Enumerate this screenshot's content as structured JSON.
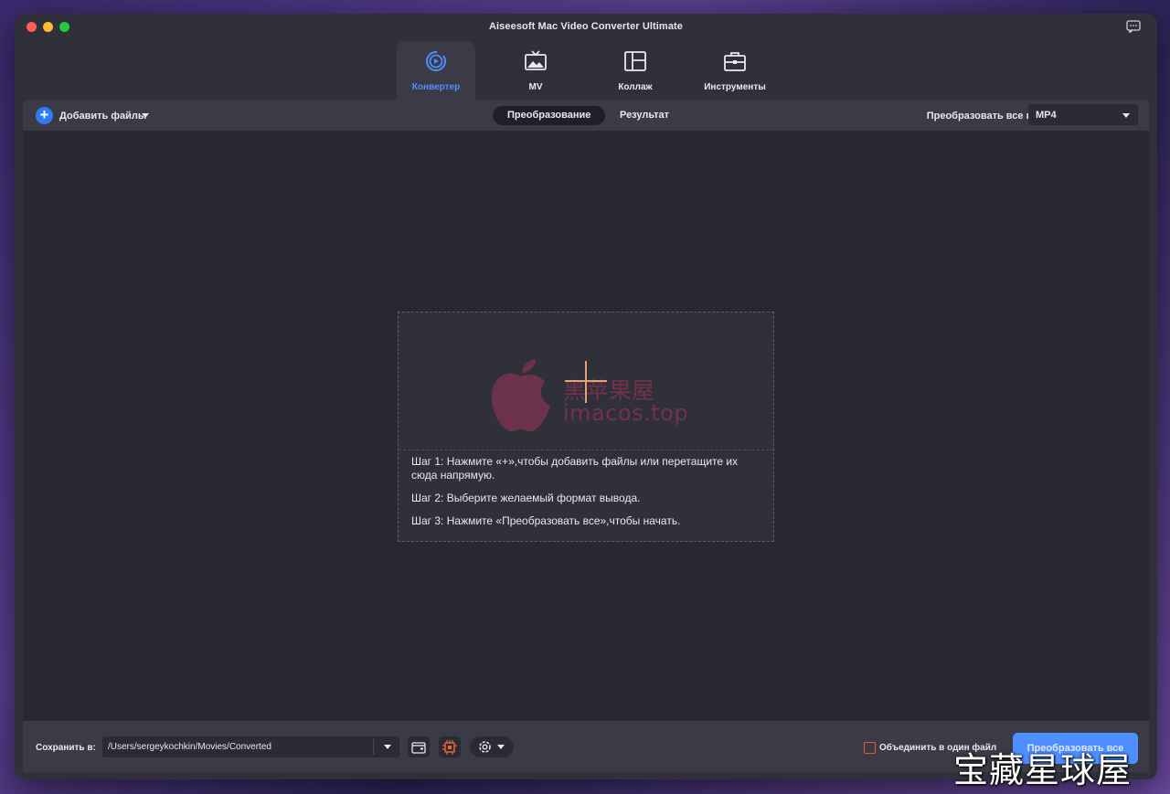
{
  "window": {
    "title": "Aiseesoft Mac Video Converter Ultimate"
  },
  "tabs": [
    {
      "label": "Конвертер",
      "icon": "converter-icon",
      "active": true
    },
    {
      "label": "MV",
      "icon": "tv-icon",
      "active": false
    },
    {
      "label": "Коллаж",
      "icon": "collage-icon",
      "active": false
    },
    {
      "label": "Инструменты",
      "icon": "toolbox-icon",
      "active": false
    }
  ],
  "toolbar": {
    "add_files_label": "Добавить файлы",
    "segments": [
      "Преобразование",
      "Результат"
    ],
    "convert_all_to_label": "Преобразовать все в:",
    "format_value": "MP4"
  },
  "dropzone": {
    "steps": [
      "Шаг 1: Нажмите «+»,чтобы добавить файлы или перетащите их сюда напрямую.",
      "Шаг 2: Выберите желаемый формат вывода.",
      "Шаг 3: Нажмите «Преобразовать все»,чтобы начать."
    ],
    "watermark_cn": "黑苹果屋",
    "watermark_url": "imacos.top"
  },
  "bottom": {
    "save_to_label": "Сохранить в:",
    "path_value": "/Users/sergeykochkin/Movies/Converted",
    "merge_label": "Объединить в один файл",
    "convert_button": "Преобразовать все"
  },
  "brand_watermark": "宝藏星球屋",
  "colors": {
    "accent": "#4d8fff",
    "window_bg": "#2f3039",
    "main_bg": "#272830",
    "checkbox": "#e05a3a"
  }
}
